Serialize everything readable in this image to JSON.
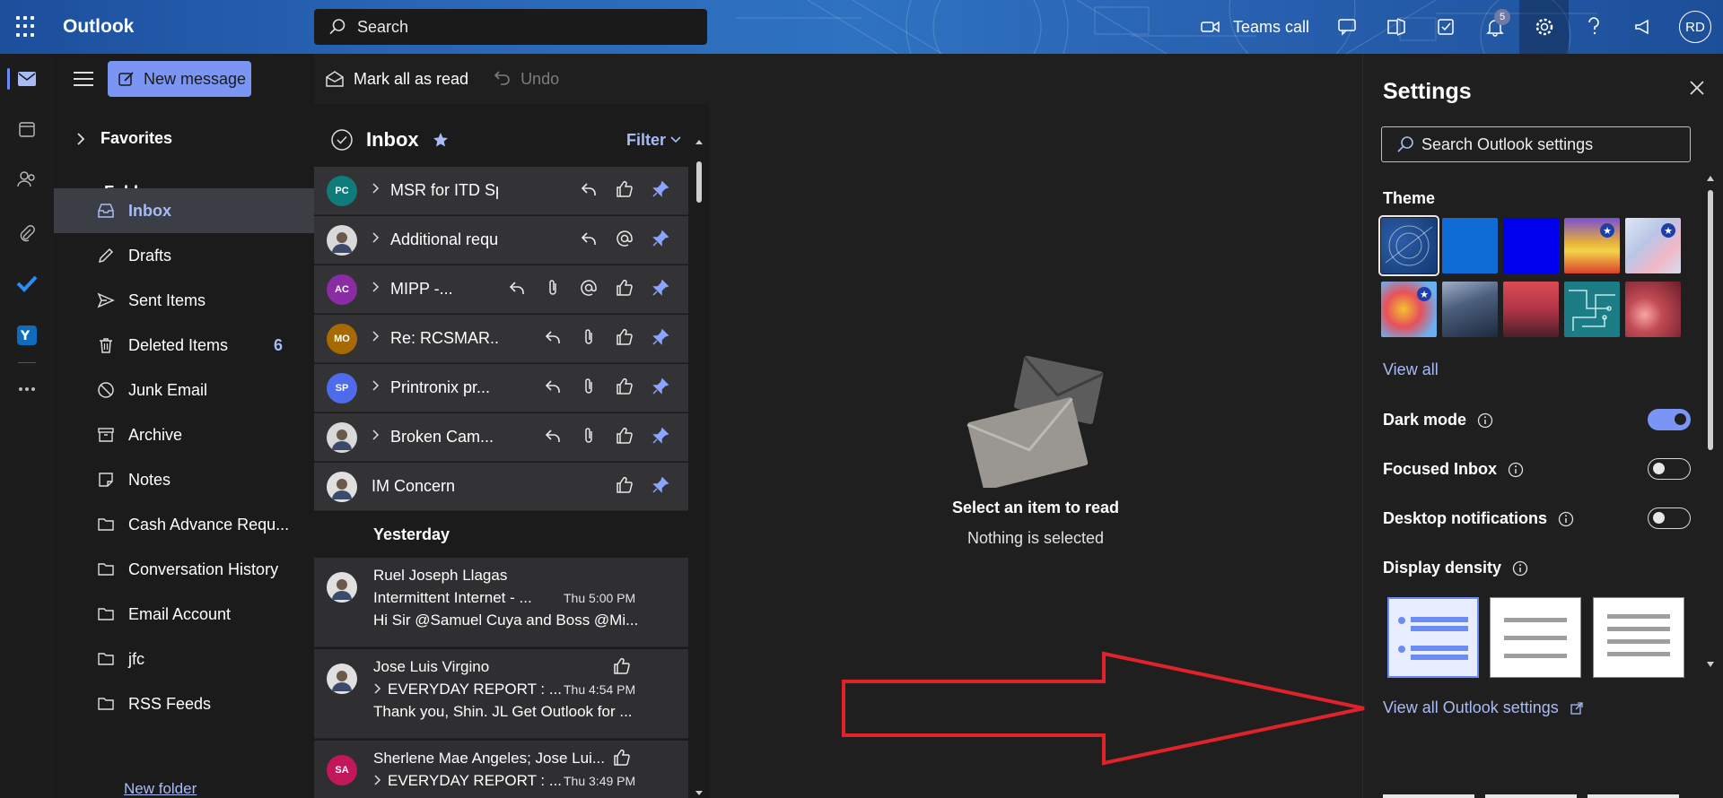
{
  "topbar": {
    "app_name": "Outlook",
    "search_placeholder": "Search",
    "teams_call": "Teams call",
    "notification_count": "5",
    "user_initials": "RD"
  },
  "folder_pane": {
    "new_message": "New message",
    "favorites": "Favorites",
    "folders": "Folders",
    "items": [
      {
        "label": "Inbox",
        "icon": "inbox-icon"
      },
      {
        "label": "Drafts",
        "icon": "pencil-icon"
      },
      {
        "label": "Sent Items",
        "icon": "send-icon"
      },
      {
        "label": "Deleted Items",
        "icon": "trash-icon",
        "count": "6"
      },
      {
        "label": "Junk Email",
        "icon": "block-icon"
      },
      {
        "label": "Archive",
        "icon": "archive-icon"
      },
      {
        "label": "Notes",
        "icon": "note-icon"
      },
      {
        "label": "Cash Advance Requ...",
        "icon": "folder-icon"
      },
      {
        "label": "Conversation History",
        "icon": "folder-icon"
      },
      {
        "label": "Email Account",
        "icon": "folder-icon"
      },
      {
        "label": "jfc",
        "icon": "folder-icon"
      },
      {
        "label": "RSS Feeds",
        "icon": "folder-icon"
      }
    ],
    "new_folder": "New folder"
  },
  "commands": {
    "mark_all_read": "Mark all as read",
    "undo": "Undo"
  },
  "message_list": {
    "title": "Inbox",
    "filter": "Filter",
    "pinned": [
      {
        "initials": "PC",
        "color": "#0f7b7b",
        "subject": "MSR for ITD Spar..."
      },
      {
        "initials": "",
        "color": "#d9d9d9",
        "subject": "Additional reques..."
      },
      {
        "initials": "AC",
        "color": "#8a2ca3",
        "subject": "MIPP -..."
      },
      {
        "initials": "MO",
        "color": "#a66a00",
        "subject": "Re: RCSMAR..."
      },
      {
        "initials": "SP",
        "color": "#4f6bed",
        "subject": "Printronix pr..."
      },
      {
        "initials": "",
        "color": "#d9d9d9",
        "subject": "Broken Cam..."
      },
      {
        "initials": "",
        "color": "#e0e0e0",
        "subject": "IM Concern"
      }
    ],
    "yesterday_label": "Yesterday",
    "recent": [
      {
        "initials": "",
        "color": "#e0e0e0",
        "sender": "Ruel Joseph Llagas",
        "subject": "Intermittent Internet - ...",
        "time": "Thu 5:00 PM",
        "preview": "Hi Sir @Samuel Cuya and Boss @Mi..."
      },
      {
        "initials": "",
        "color": "#e0e0e0",
        "sender": "Jose Luis Virgino",
        "subject": "EVERYDAY REPORT : ...",
        "time": "Thu 4:54 PM",
        "preview": "Thank you, Shin. JL Get Outlook for ..."
      },
      {
        "initials": "SA",
        "color": "#c2185b",
        "sender": "Sherlene Mae Angeles; Jose Lui...",
        "subject": "EVERYDAY REPORT : ...",
        "time": "Thu 3:49 PM",
        "preview": ""
      }
    ]
  },
  "reading_pane": {
    "title": "Select an item to read",
    "subtitle": "Nothing is selected"
  },
  "settings": {
    "title": "Settings",
    "search_placeholder": "Search Outlook settings",
    "theme_label": "Theme",
    "view_all": "View all",
    "dark_mode": "Dark mode",
    "dark_mode_on": true,
    "focused_inbox": "Focused Inbox",
    "focused_inbox_on": false,
    "desktop_notifications": "Desktop notifications",
    "desktop_notifications_on": false,
    "display_density": "Display density",
    "view_all_outlook": "View all Outlook settings"
  },
  "colors": {
    "accent": "#7b95f5",
    "accent_text": "#a9bbf7",
    "annotation_arrow": "#e0222a"
  }
}
